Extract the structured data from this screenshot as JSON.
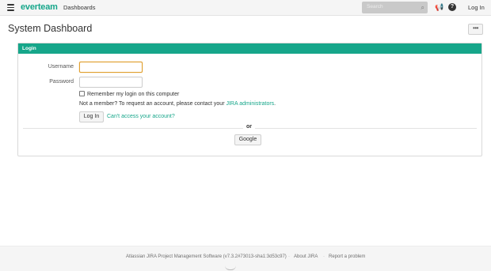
{
  "header": {
    "logo": "everteam",
    "nav_dashboards": "Dashboards",
    "search_placeholder": "Search",
    "login_link": "Log In",
    "help_glyph": "?"
  },
  "page": {
    "title": "System Dashboard",
    "more_label": "•••"
  },
  "login": {
    "panel_title": "Login",
    "username_label": "Username",
    "password_label": "Password",
    "username_value": "",
    "password_value": "",
    "remember_label": "Remember my login on this computer",
    "remember_checked": false,
    "member_text": "Not a member? To request an account, please contact your",
    "member_link": "JIRA administrators",
    "member_end": ".",
    "login_button": "Log In",
    "cant_access": "Can't access your account?",
    "or_text": "or",
    "google_button": "Google"
  },
  "footer": {
    "version_text": "Atlassian JIRA Project Management Software (v7.3.2#73013-sha1:3d53c97)",
    "sep": "·",
    "about": "About JIRA",
    "report": "Report a problem"
  },
  "colors": {
    "accent": "#16a68a",
    "panel_header": "#16a68a",
    "focus_border": "#e0a030"
  },
  "icons": {
    "menu": "hamburger-icon",
    "search": "search-icon",
    "notifications": "megaphone-icon",
    "help": "help-icon"
  }
}
